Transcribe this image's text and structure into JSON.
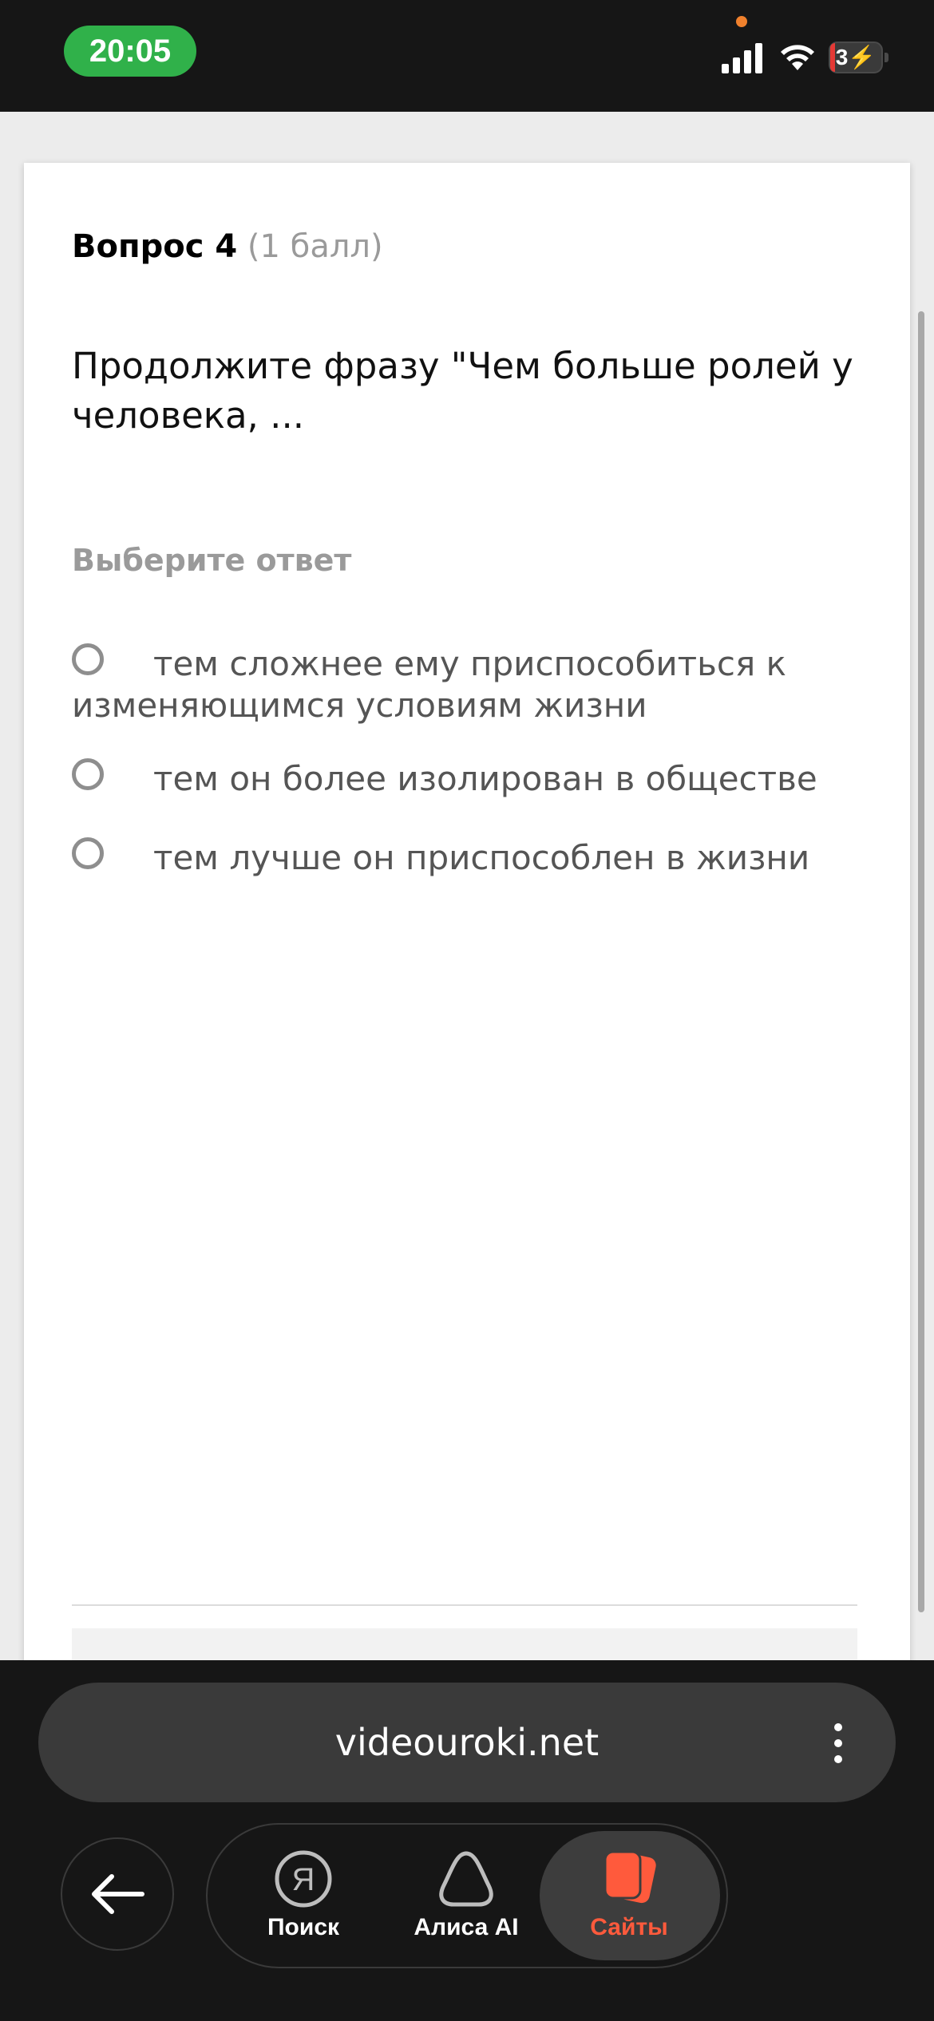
{
  "status_bar": {
    "time": "20:05",
    "battery_level": "3",
    "icons": [
      "signal-icon",
      "wifi-icon",
      "battery-charging-icon"
    ]
  },
  "question": {
    "title": "Вопрос 4",
    "points": "(1 балл)",
    "text": "Продолжите фразу \"Чем больше ролей у человека, ...",
    "prompt": "Выберите ответ",
    "options": [
      "тем сложнее ему приспособиться к изменяющимся условиям жизни",
      "тем он более изолирован в обществе",
      "тем лучше он приспособлен в жизни"
    ]
  },
  "browser": {
    "url": "videouroki.net",
    "nav": [
      {
        "label": "Поиск",
        "icon": "yandex-search-icon",
        "active": false
      },
      {
        "label": "Алиса AI",
        "icon": "alice-icon",
        "active": false
      },
      {
        "label": "Сайты",
        "icon": "sites-tabs-icon",
        "active": true
      }
    ]
  },
  "colors": {
    "accent": "#ff5a3c",
    "time_pill": "#30b14a",
    "dark_bar": "#161616"
  }
}
